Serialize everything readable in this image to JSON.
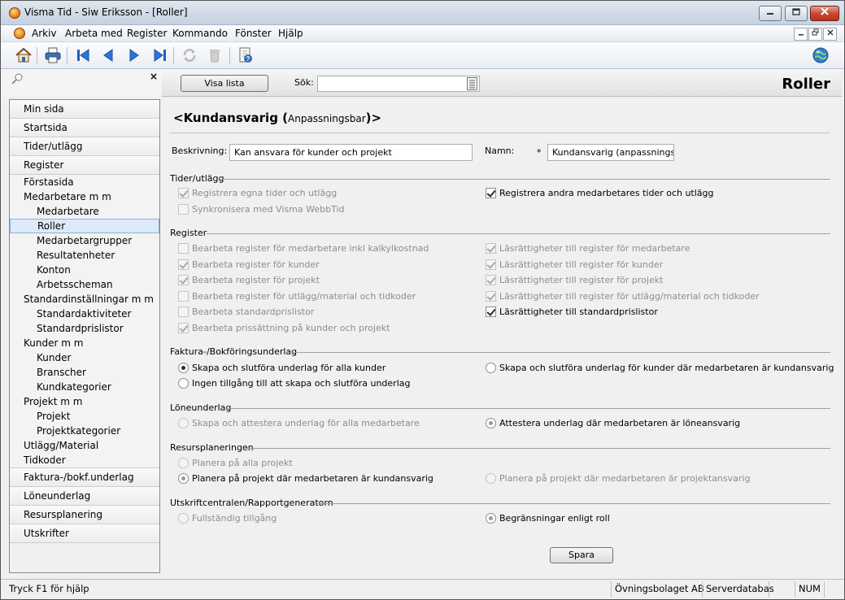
{
  "window": {
    "title": "Visma Tid - Siw Eriksson - [Roller]"
  },
  "menubar": {
    "items": [
      "Arkiv",
      "Arbeta med",
      "Register",
      "Kommando",
      "Fönster",
      "Hjälp"
    ]
  },
  "toolbar": {
    "icons": [
      "home-icon",
      "print-icon",
      "first-record-icon",
      "previous-record-icon",
      "next-record-icon",
      "last-record-icon",
      "refresh-icon",
      "delete-icon",
      "help-icon",
      "web-icon"
    ]
  },
  "sidebar": {
    "close_glyph": "×",
    "items": [
      {
        "label": "Min sida",
        "level": "section"
      },
      {
        "label": "Startsida",
        "level": "section"
      },
      {
        "label": "Tider/utlägg",
        "level": "section"
      },
      {
        "label": "Register",
        "level": "section"
      },
      {
        "label": "Förstasida",
        "level": "l1"
      },
      {
        "label": "Medarbetare m m",
        "level": "l1"
      },
      {
        "label": "Medarbetare",
        "level": "l2"
      },
      {
        "label": "Roller",
        "level": "l2",
        "selected": true
      },
      {
        "label": "Medarbetargrupper",
        "level": "l2"
      },
      {
        "label": "Resultatenheter",
        "level": "l2"
      },
      {
        "label": "Konton",
        "level": "l2"
      },
      {
        "label": "Arbetsscheman",
        "level": "l2"
      },
      {
        "label": "Standardinställningar m m",
        "level": "l1"
      },
      {
        "label": "Standardaktiviteter",
        "level": "l2"
      },
      {
        "label": "Standardprislistor",
        "level": "l2"
      },
      {
        "label": "Kunder m m",
        "level": "l1"
      },
      {
        "label": "Kunder",
        "level": "l2"
      },
      {
        "label": "Branscher",
        "level": "l2"
      },
      {
        "label": "Kundkategorier",
        "level": "l2"
      },
      {
        "label": "Projekt m m",
        "level": "l1"
      },
      {
        "label": "Projekt",
        "level": "l2"
      },
      {
        "label": "Projektkategorier",
        "level": "l2"
      },
      {
        "label": "Utlägg/Material",
        "level": "l1"
      },
      {
        "label": "Tidkoder",
        "level": "l1"
      },
      {
        "label": "Faktura-/bokf.underlag",
        "level": "section"
      },
      {
        "label": "Löneunderlag",
        "level": "section"
      },
      {
        "label": "Resursplanering",
        "level": "section"
      },
      {
        "label": "Utskrifter",
        "level": "section"
      }
    ]
  },
  "search": {
    "show_list_label": "Visa lista",
    "label": "Sök:",
    "value": ""
  },
  "page": {
    "heading": "Roller"
  },
  "form": {
    "title_main": "<Kundansvarig (",
    "title_small": "Anpassningsbar",
    "title_end": ")>",
    "description_label": "Beskrivning:",
    "description_value": "Kan ansvara för kunder och projekt",
    "name_label": "Namn:",
    "required_mark": "*",
    "name_value": "Kundansvarig (anpassningsbar)",
    "save_label": "Spara",
    "groups": {
      "tider": {
        "title": "Tider/utlägg",
        "options": [
          {
            "label": "Registrera egna tider och utlägg",
            "type": "checkbox",
            "checked": true,
            "disabled": true
          },
          {
            "label": "Registrera andra medarbetares tider och utlägg",
            "type": "checkbox",
            "checked": true,
            "disabled": false
          },
          {
            "label": "Synkronisera med Visma WebbTid",
            "type": "checkbox",
            "checked": false,
            "disabled": true
          }
        ]
      },
      "register": {
        "title": "Register",
        "options": [
          {
            "label": "Bearbeta register för medarbetare inkl kalkylkostnad",
            "type": "checkbox",
            "checked": false,
            "disabled": true
          },
          {
            "label": "Läsrättigheter till register för medarbetare",
            "type": "checkbox",
            "checked": true,
            "disabled": true
          },
          {
            "label": "Bearbeta register för kunder",
            "type": "checkbox",
            "checked": true,
            "disabled": true
          },
          {
            "label": "Läsrättigheter till register för kunder",
            "type": "checkbox",
            "checked": true,
            "disabled": true
          },
          {
            "label": "Bearbeta register för projekt",
            "type": "checkbox",
            "checked": true,
            "disabled": true
          },
          {
            "label": "Läsrättigheter till register för projekt",
            "type": "checkbox",
            "checked": true,
            "disabled": true
          },
          {
            "label": "Bearbeta register för utlägg/material och tidkoder",
            "type": "checkbox",
            "checked": false,
            "disabled": true
          },
          {
            "label": "Läsrättigheter till register för utlägg/material och tidkoder",
            "type": "checkbox",
            "checked": true,
            "disabled": true
          },
          {
            "label": "Bearbeta standardprislistor",
            "type": "checkbox",
            "checked": false,
            "disabled": true
          },
          {
            "label": "Läsrättigheter till standardprislistor",
            "type": "checkbox",
            "checked": true,
            "disabled": false
          },
          {
            "label": "Bearbeta prissättning på kunder och projekt",
            "type": "checkbox",
            "checked": true,
            "disabled": true
          }
        ]
      },
      "faktura": {
        "title": "Faktura-/Bokföringsunderlag",
        "options": [
          {
            "label": "Skapa och slutföra underlag för alla kunder",
            "type": "radio",
            "checked": true,
            "disabled": false
          },
          {
            "label": "Skapa och slutföra underlag för kunder där medarbetaren är kundansvarig",
            "type": "radio",
            "checked": false,
            "disabled": false
          },
          {
            "label": "Ingen tillgång till att skapa och slutföra underlag",
            "type": "radio",
            "checked": false,
            "disabled": false
          }
        ]
      },
      "lone": {
        "title": "Löneunderlag",
        "options": [
          {
            "label": "Skapa och attestera underlag för alla medarbetare",
            "type": "radio",
            "checked": false,
            "disabled": true
          },
          {
            "label": "Attestera underlag där medarbetaren är löneansvarig",
            "type": "radio",
            "checked": true,
            "disabled": false
          }
        ]
      },
      "resurs": {
        "title": "Resursplaneringen",
        "options": [
          {
            "label": "Planera på alla projekt",
            "type": "radio",
            "checked": false,
            "disabled": true
          },
          {
            "label": "Planera på projekt där medarbetaren är kundansvarig",
            "type": "radio",
            "checked": true,
            "disabled": false
          },
          {
            "label": "Planera på projekt där medarbetaren är projektansvarig",
            "type": "radio",
            "checked": false,
            "disabled": true
          }
        ]
      },
      "utskrift": {
        "title": "Utskriftcentralen/Rapportgeneratorn",
        "options": [
          {
            "label": "Fullständig tillgång",
            "type": "radio",
            "checked": false,
            "disabled": true
          },
          {
            "label": "Begränsningar enligt roll",
            "type": "radio",
            "checked": true,
            "disabled": false
          }
        ]
      }
    }
  },
  "statusbar": {
    "help": "Tryck F1 för hjälp",
    "company": "Övningsbolaget AB",
    "database": "Serverdatabas",
    "num": "NUM"
  }
}
